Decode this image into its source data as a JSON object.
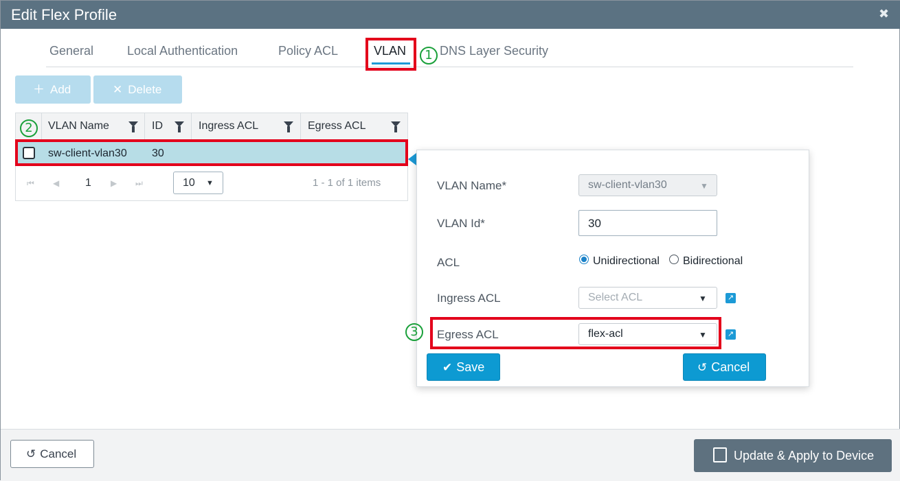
{
  "window": {
    "title": "Edit Flex Profile",
    "close_glyph": "✖"
  },
  "tabs": [
    {
      "label": "General"
    },
    {
      "label": "Local Authentication"
    },
    {
      "label": "Policy ACL"
    },
    {
      "label": "VLAN",
      "active": true
    },
    {
      "label": "DNS Layer Security"
    }
  ],
  "markers": [
    "1",
    "2",
    "3"
  ],
  "toolbar": {
    "add_label": "Add",
    "delete_label": "Delete"
  },
  "grid": {
    "columns": [
      "VLAN Name",
      "ID",
      "Ingress ACL",
      "Egress ACL"
    ],
    "rows": [
      {
        "vlan_name": "sw-client-vlan30",
        "id": "30",
        "ingress_acl": "",
        "egress_acl": ""
      }
    ],
    "pager": {
      "page": "1",
      "page_size": "10",
      "info": "1 - 1 of 1 items"
    }
  },
  "vlan_form": {
    "vlan_name_label": "VLAN Name*",
    "vlan_name_value": "sw-client-vlan30",
    "vlan_id_label": "VLAN Id*",
    "vlan_id_value": "30",
    "acl_label": "ACL",
    "acl_options": [
      "Unidirectional",
      "Bidirectional"
    ],
    "acl_selected": "Unidirectional",
    "ingress_label": "Ingress ACL",
    "ingress_placeholder": "Select ACL",
    "egress_label": "Egress ACL",
    "egress_value": "flex-acl",
    "save_label": "Save",
    "cancel_label": "Cancel"
  },
  "footer": {
    "cancel_label": "Cancel",
    "apply_label": "Update & Apply to Device"
  },
  "colors": {
    "titlebar": "#5b7282",
    "accent": "#1c9ad6",
    "highlight": "#e3001b",
    "marker": "#1aa03a",
    "selected_row": "#b7dde6"
  }
}
